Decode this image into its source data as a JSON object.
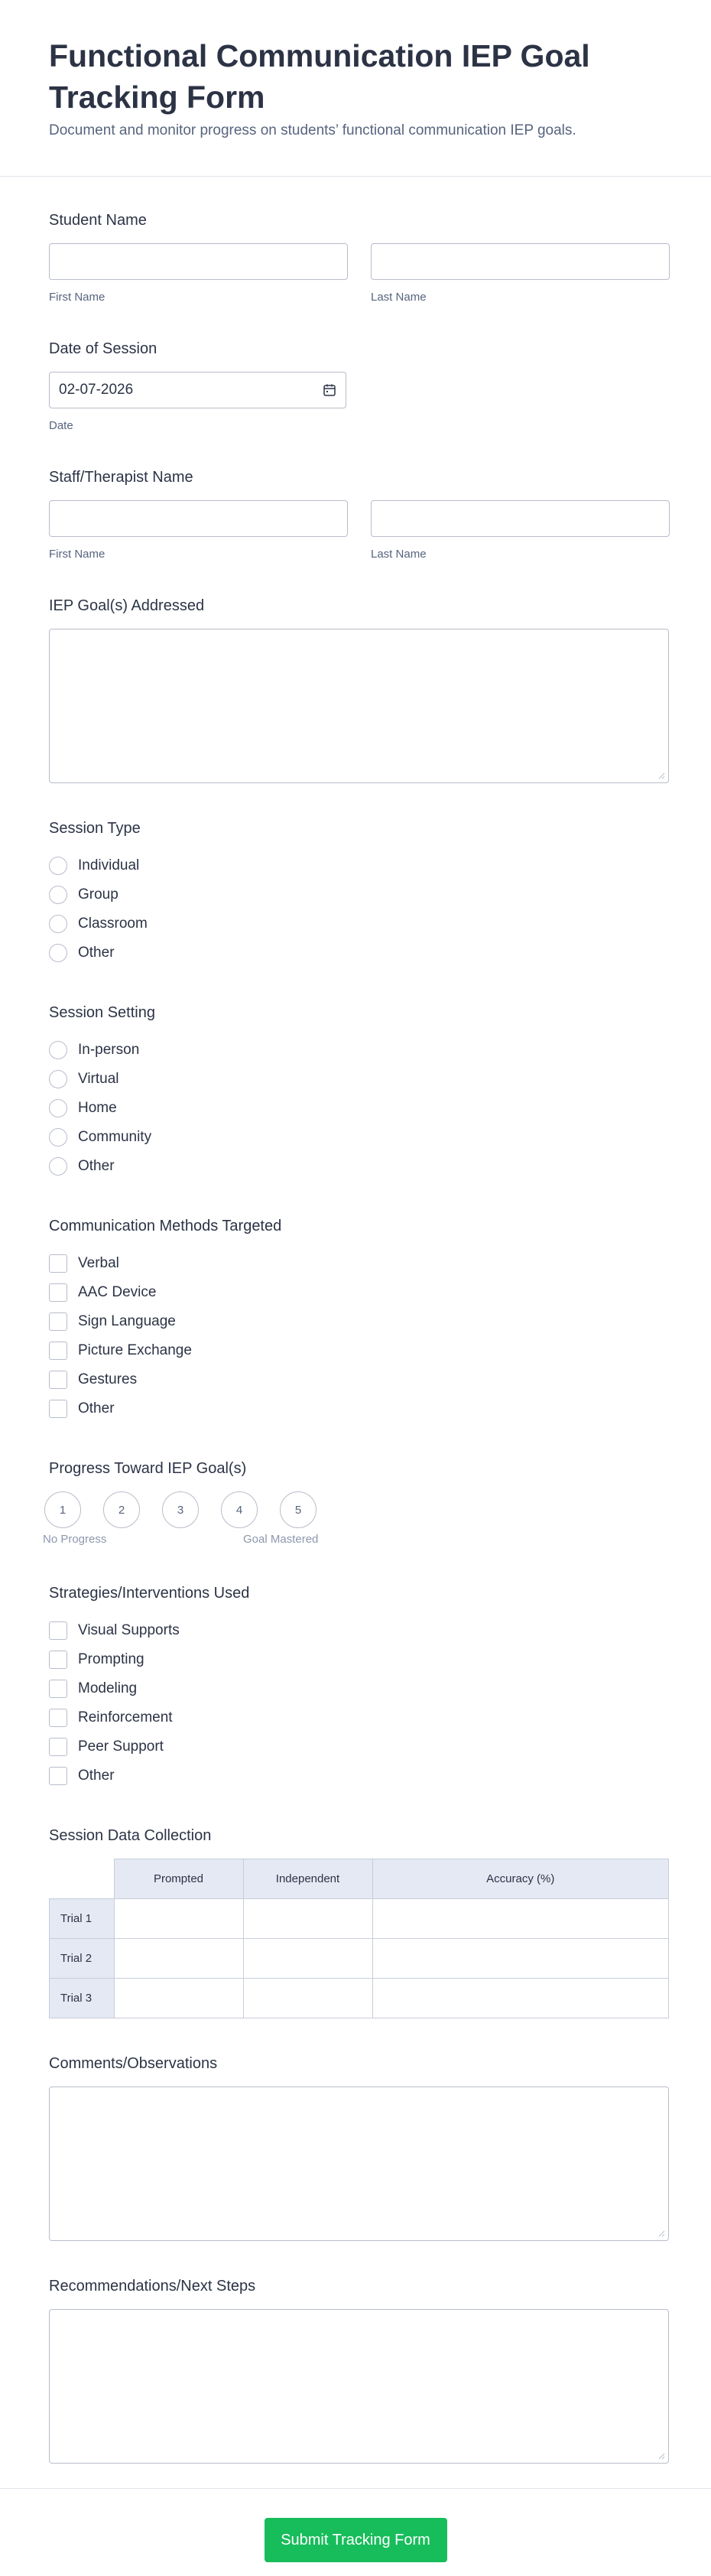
{
  "form": {
    "title": "Functional Communication IEP Goal Tracking Form",
    "subtitle": "Document and monitor progress on students’ functional communication IEP goals."
  },
  "student_name": {
    "label": "Student Name",
    "first_sublabel": "First Name",
    "last_sublabel": "Last Name"
  },
  "date_of_session": {
    "label": "Date of Session",
    "value": "02-07-2026",
    "sublabel": "Date",
    "icon": "calendar-icon"
  },
  "staff_name": {
    "label": "Staff/Therapist Name",
    "first_sublabel": "First Name",
    "last_sublabel": "Last Name"
  },
  "iep_goals": {
    "label": "IEP Goal(s) Addressed"
  },
  "session_type": {
    "label": "Session Type",
    "options": [
      "Individual",
      "Group",
      "Classroom",
      "Other"
    ]
  },
  "session_setting": {
    "label": "Session Setting",
    "options": [
      "In-person",
      "Virtual",
      "Home",
      "Community",
      "Other"
    ]
  },
  "comm_methods": {
    "label": "Communication Methods Targeted",
    "options": [
      "Verbal",
      "AAC Device",
      "Sign Language",
      "Picture Exchange",
      "Gestures",
      "Other"
    ]
  },
  "progress": {
    "label": "Progress Toward IEP Goal(s)",
    "scale": [
      "1",
      "2",
      "3",
      "4",
      "5"
    ],
    "min_label": "No Progress",
    "max_label": "Goal Mastered"
  },
  "strategies": {
    "label": "Strategies/Interventions Used",
    "options": [
      "Visual Supports",
      "Prompting",
      "Modeling",
      "Reinforcement",
      "Peer Support",
      "Other"
    ]
  },
  "data_collection": {
    "label": "Session Data Collection",
    "columns": [
      "Prompted",
      "Independent",
      "Accuracy (%)"
    ],
    "rows": [
      "Trial 1",
      "Trial 2",
      "Trial 3"
    ]
  },
  "comments": {
    "label": "Comments/Observations"
  },
  "recommendations": {
    "label": "Recommendations/Next Steps"
  },
  "submit": {
    "label": "Submit Tracking Form"
  },
  "colors": {
    "accent": "#18bd5b",
    "text": "#2c3345",
    "muted": "#57647e",
    "border": "#b8bdc9",
    "table_header": "#e4e9f4"
  }
}
